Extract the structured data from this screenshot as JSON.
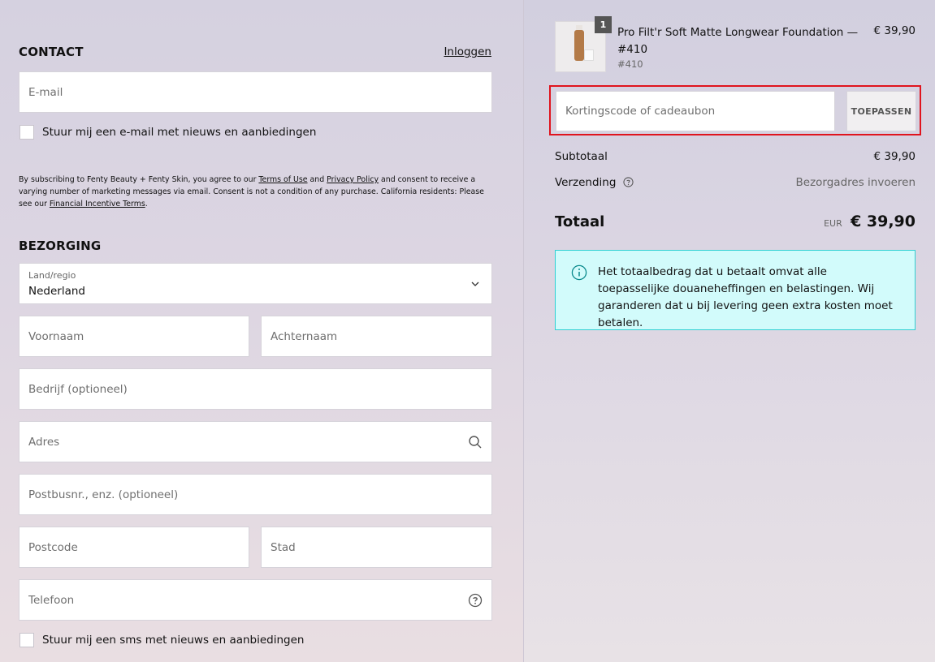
{
  "contact": {
    "heading": "CONTACT",
    "login_link": "Inloggen",
    "email_placeholder": "E-mail",
    "newsletter_label": "Stuur mij een e-mail met nieuws en aanbiedingen"
  },
  "legal": {
    "part1": "By subscribing to Fenty Beauty + Fenty Skin, you agree to our ",
    "terms": "Terms of Use",
    "part2": " and ",
    "privacy": "Privacy Policy",
    "part3": " and consent to receive a varying number of marketing messages via email. Consent is not a condition of any purchase. California residents: Please see our ",
    "financial": "Financial Incentive Terms",
    "part4": "."
  },
  "delivery": {
    "heading": "BEZORGING",
    "country_label": "Land/regio",
    "country_value": "Nederland",
    "first_name": "Voornaam",
    "last_name": "Achternaam",
    "company": "Bedrijf (optioneel)",
    "address": "Adres",
    "address2": "Postbusnr., enz. (optioneel)",
    "postcode": "Postcode",
    "city": "Stad",
    "phone": "Telefoon",
    "sms_label": "Stuur mij een sms met nieuws en aanbiedingen"
  },
  "cart": {
    "quantity": "1",
    "product_name": "Pro Filt'r Soft Matte Longwear Foundation — #410",
    "variant": "#410",
    "price": "€ 39,90"
  },
  "discount": {
    "placeholder": "Kortingscode of cadeaubon",
    "apply_label": "TOEPASSEN"
  },
  "summary": {
    "subtotal_label": "Subtotaal",
    "subtotal_value": "€ 39,90",
    "shipping_label": "Verzending",
    "shipping_value": "Bezorgadres invoeren",
    "total_label": "Totaal",
    "currency": "EUR",
    "total_value": "€ 39,90"
  },
  "notice": {
    "text": "Het totaalbedrag dat u betaalt omvat alle toepasselijke douaneheffingen en belastingen. Wij garanderen dat u bij levering geen extra kosten moet betalen."
  },
  "colors": {
    "highlight_border": "#e0141e",
    "notice_bg": "#d2fbfb",
    "notice_border": "#2fd0d3"
  }
}
